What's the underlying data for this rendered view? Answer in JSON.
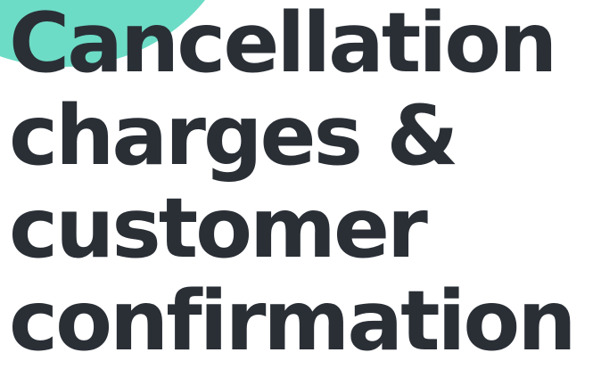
{
  "colors": {
    "accent": "#6ddcc6",
    "text": "#2a2f36",
    "background": "#ffffff"
  },
  "heading": {
    "lines": [
      "Cancellation",
      "charges &",
      "customer",
      "confirmation"
    ]
  }
}
